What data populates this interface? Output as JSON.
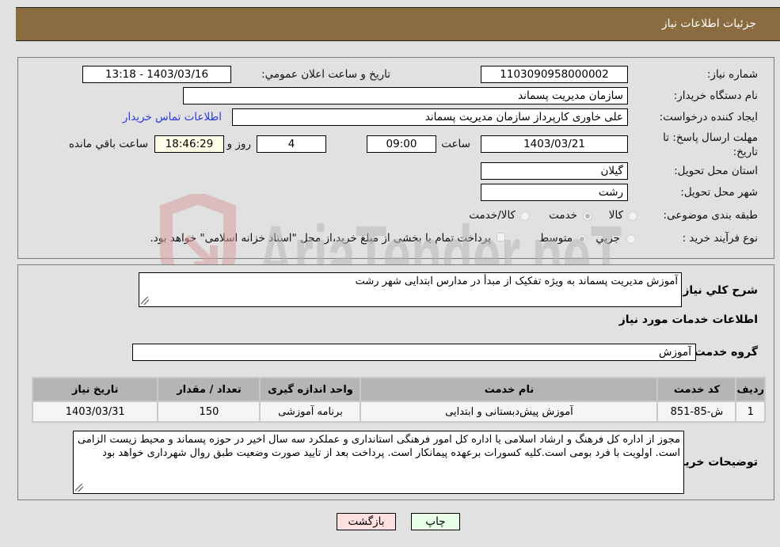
{
  "header": {
    "title": "جزئیات اطلاعات نیاز"
  },
  "details": {
    "need_number": {
      "label": "شماره نیاز:",
      "value": "1103090958000002"
    },
    "announce_datetime": {
      "label": "تاریخ و ساعت اعلان عمومي:",
      "value": "1403/03/16 - 13:18"
    },
    "buyer_org": {
      "label": "نام دستگاه خريدار:",
      "value": "سازمان مدیریت پسماند"
    },
    "requester": {
      "label": "ایجاد کننده درخواست:",
      "value": "علی خاوری کارپرداز سازمان مدیریت پسماند"
    },
    "buyer_contact_link": "اطلاعات تماس خريدار",
    "deadline": {
      "label": "مهلت ارسال پاسخ: تا تاریخ:",
      "date": "1403/03/21",
      "time_label": "ساعت",
      "time": "09:00",
      "days": "4",
      "days_label": "روز و",
      "remaining": "18:46:29",
      "remaining_label": "ساعت باقي مانده"
    },
    "province": {
      "label": "استان محل تحویل:",
      "value": "گیلان"
    },
    "city": {
      "label": "شهر محل تحویل:",
      "value": "رشت"
    },
    "category": {
      "label": "طبقه بندی موضوعی:",
      "options": [
        "کالا",
        "خدمت",
        "کالا/خدمت"
      ],
      "selected": "خدمت"
    },
    "purchase_type": {
      "label": "نوع فرآیند خرید :",
      "options": [
        "جزيي",
        "متوسط"
      ],
      "selected": "متوسط",
      "treasury_note": "پرداخت تمام یا بخشی از مبلغ خرید،از محل \"اسناد خزانه اسلامی\" خواهد بود.",
      "treasury_checked": false
    }
  },
  "summary": {
    "label": "شرح کلي نياز:",
    "value": "آموزش مدیریت پسماند به ویژه تفکیک از مبدأ در مدارس ابتدایی شهر رشت"
  },
  "services": {
    "section_title": "اطلاعات خدمات مورد نياز",
    "group_label": "گروه خدمت:",
    "group_value": "آموزش",
    "table": {
      "headers": [
        "رديف",
        "کد خدمت",
        "نام خدمت",
        "واحد اندازه گيری",
        "تعداد / مقدار",
        "تاريخ نياز"
      ],
      "rows": [
        [
          "1",
          "ش-85-851",
          "آموزش پیش‌دبستانی و ابتدایی",
          "برنامه آموزشی",
          "150",
          "1403/03/31"
        ]
      ]
    }
  },
  "buyer_notes": {
    "label": "توضيحات خريدار:",
    "value": "مجوز از اداره کل فرهنگ و ارشاد اسلامی یا اداره کل امور فرهنگی استانداری و عملکرد سه سال اخیر در حوزه پسماند و محیط زیست الزامی است. اولویت با فرد بومی است.کلیه کسورات برعهده پیمانکار است. پرداخت بعد از تایید صورت وضعیت طبق روال شهرداری خواهد بود"
  },
  "buttons": {
    "print": "چاپ",
    "back": "بازگشت"
  },
  "watermark": {
    "text": "AriaTender.neT"
  }
}
